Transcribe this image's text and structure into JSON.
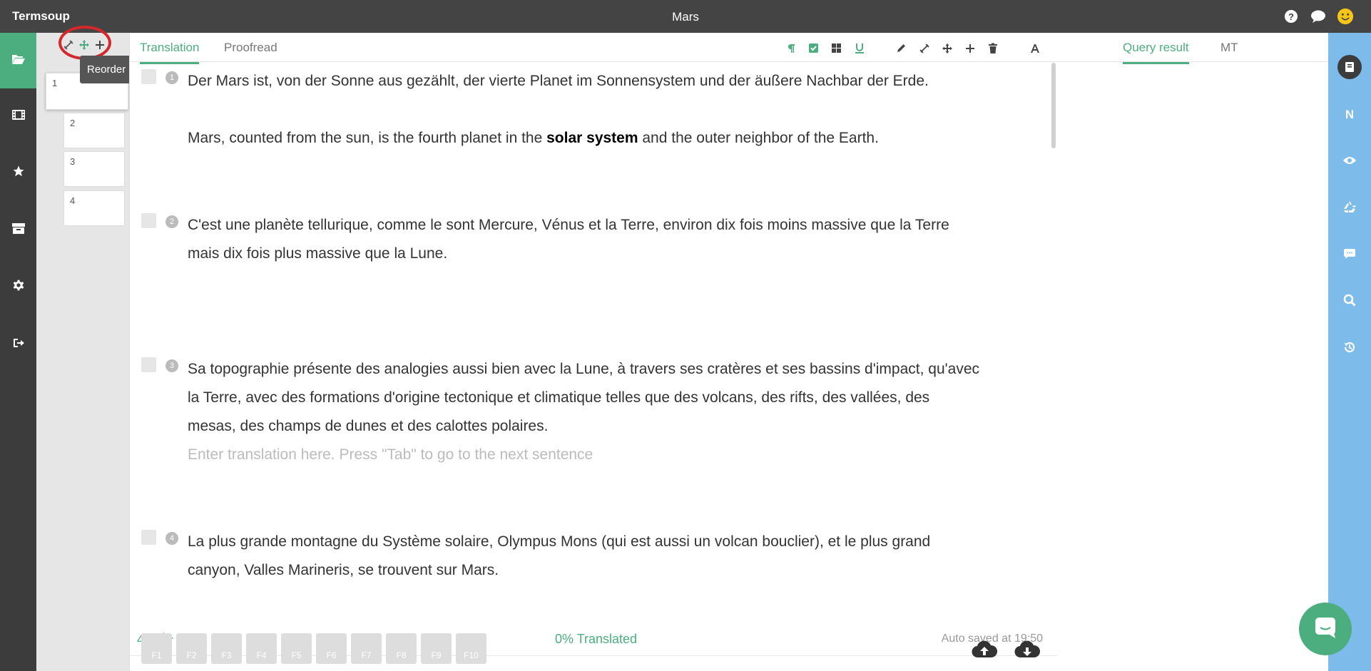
{
  "app": {
    "name": "Termsoup",
    "doc_title": "Mars"
  },
  "colors": {
    "accent": "#4cae7f",
    "dark": "#444444",
    "right_rail": "#7dbbea"
  },
  "left_nav": [
    {
      "icon": "folder-open-icon",
      "active": true
    },
    {
      "icon": "film-icon"
    },
    {
      "icon": "star-icon"
    },
    {
      "icon": "archive-box-icon"
    },
    {
      "icon": "gear-icon"
    },
    {
      "icon": "sign-out-icon"
    }
  ],
  "para_panel": {
    "tooltip": "Reorder  paragraph",
    "cards": [
      "1",
      "2",
      "3",
      "4"
    ]
  },
  "tabs": {
    "translation": "Translation",
    "proofread": "Proofread"
  },
  "segments": [
    {
      "num": "1",
      "source": "Der Mars ist, von der Sonne aus gezählt, der vierte Planet im Sonnensystem und der äußere Nachbar der Erde.",
      "target_before": "Mars, counted from the sun, is the fourth planet in the ",
      "target_bold": "solar system",
      "target_after": " and the outer neighbor of the Earth."
    },
    {
      "num": "2",
      "source": "C'est une planète tellurique, comme le sont Mercure, Vénus et la Terre, environ dix fois moins massive que la Terre mais dix fois plus massive que la Lune."
    },
    {
      "num": "3",
      "source": "Sa topographie présente des analogies aussi bien avec la Lune, à travers ses cratères et ses bassins d'impact, qu'avec la Terre, avec des formations d'origine tectonique et climatique telles que des volcans, des rifts, des vallées, des mesas, des champs de dunes et des calottes polaires.",
      "placeholder": "Enter translation here. Press \"Tab\" to go to the next sentence"
    },
    {
      "num": "4",
      "source": "La plus grande montagne du Système solaire, Olympus Mons (qui est aussi un volcan bouclier), et le plus grand canyon, Valles Marineris, se trouvent sur Mars."
    }
  ],
  "status": {
    "source_count": "402",
    "target_count": "219",
    "translated": "0% Translated",
    "autosave": "Auto saved at 19:50"
  },
  "fkeys": [
    "F1",
    "F2",
    "F3",
    "F4",
    "F5",
    "F6",
    "F7",
    "F8",
    "F9",
    "F10"
  ],
  "right_panel": {
    "tab_query": "Query result",
    "tab_mt": "MT"
  },
  "right_rail": [
    {
      "icon": "book-icon",
      "active": true
    },
    {
      "icon": "n-letter-icon",
      "label": "N"
    },
    {
      "icon": "eye-icon"
    },
    {
      "icon": "recycle-icon"
    },
    {
      "icon": "comment-icon"
    },
    {
      "icon": "search-icon"
    },
    {
      "icon": "history-icon"
    }
  ]
}
